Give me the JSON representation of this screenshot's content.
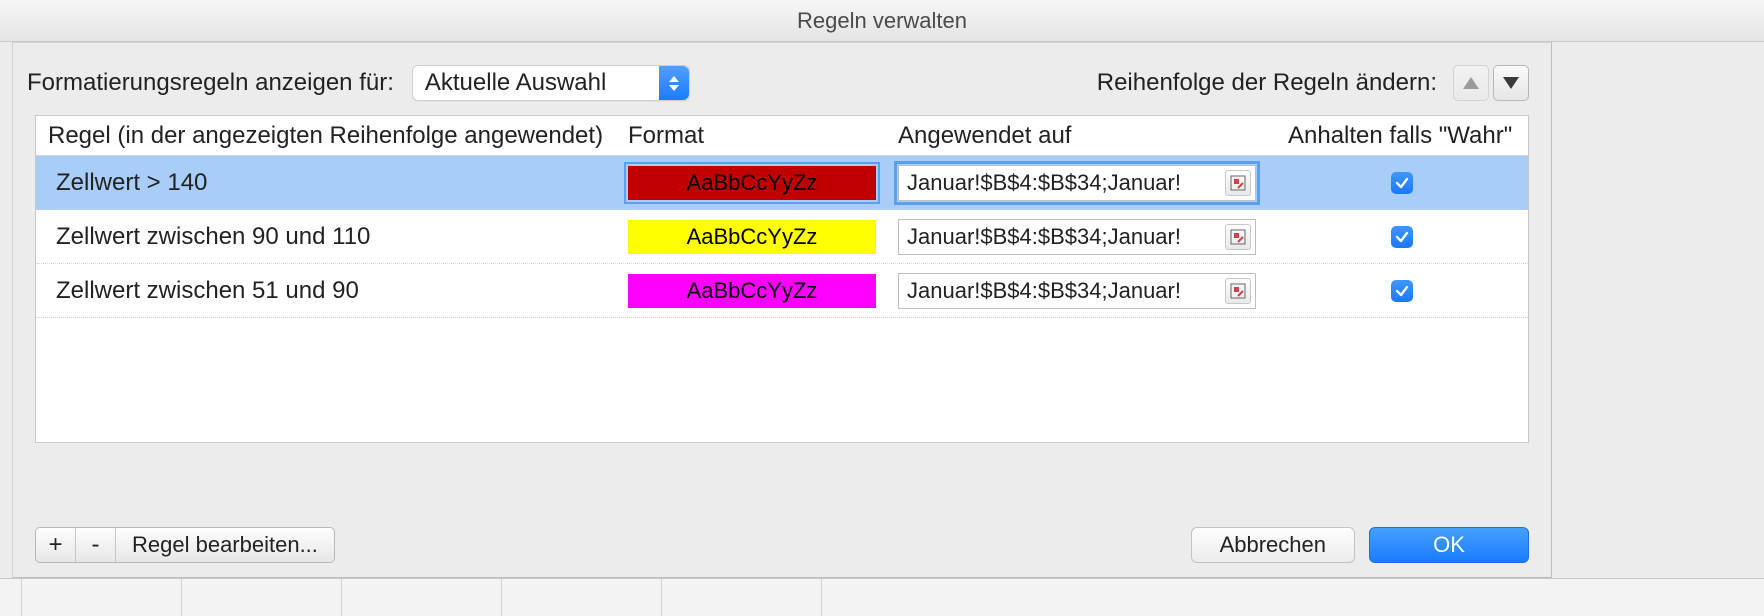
{
  "window": {
    "title": "Regeln verwalten"
  },
  "top": {
    "filter_label": "Formatierungsregeln anzeigen für:",
    "filter_value": "Aktuelle Auswahl",
    "reorder_label": "Reihenfolge der Regeln ändern:"
  },
  "columns": {
    "rule": "Regel (in der angezeigten Reihenfolge angewendet)",
    "format": "Format",
    "applies": "Angewendet auf",
    "stop": "Anhalten falls \"Wahr\""
  },
  "format_sample_text": "AaBbCcYyZz",
  "rules": [
    {
      "name": "Zellwert > 140",
      "bg": "#c00000",
      "fg": "#000000",
      "applies": "Januar!$B$4:$B$34;Januar!",
      "stop": true,
      "selected": true
    },
    {
      "name": "Zellwert zwischen 90 und 110",
      "bg": "#ffff00",
      "fg": "#000000",
      "applies": "Januar!$B$4:$B$34;Januar!",
      "stop": true,
      "selected": false
    },
    {
      "name": "Zellwert zwischen 51 und 90",
      "bg": "#ff00ff",
      "fg": "#000000",
      "applies": "Januar!$B$4:$B$34;Januar!",
      "stop": true,
      "selected": false
    }
  ],
  "buttons": {
    "add": "+",
    "remove": "-",
    "edit": "Regel bearbeiten...",
    "cancel": "Abbrechen",
    "ok": "OK"
  }
}
